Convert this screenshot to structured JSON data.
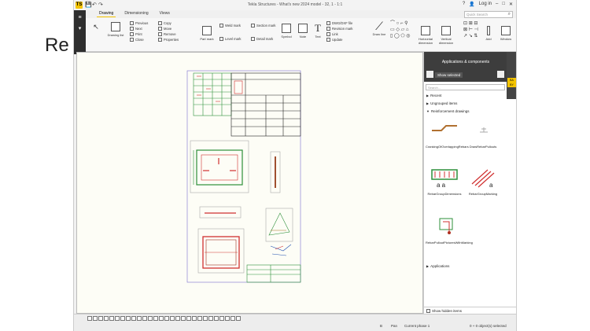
{
  "stray_text": "Re",
  "app": {
    "title": "Tekla Structures - What's new 2024 model - 32, 1 - 1:1",
    "logo": "TS",
    "account": "Log in",
    "window_controls": [
      "?",
      "👤",
      "–",
      "□",
      "✕"
    ]
  },
  "tabs": [
    "Drawing",
    "Dimensioning",
    "Views"
  ],
  "search": {
    "placeholder": "Quick Search"
  },
  "ribbon": {
    "drawing_list": "Drawing list",
    "nav": [
      "Previous",
      "Next",
      "Print",
      "Close"
    ],
    "edit": [
      "Copy",
      "Move",
      "Remove",
      "Properties"
    ],
    "marks": {
      "part_mark": "Part mark",
      "weld_mark": "Weld mark",
      "level_mark": "Level mark",
      "section_mark": "Section mark",
      "detail_mark": "Detail mark"
    },
    "symbol": "Symbol",
    "note": "Note",
    "text": "Text",
    "links": [
      "DWG/DXF file",
      "Revision mark",
      "Link",
      "Update"
    ],
    "draw_line": "Draw line",
    "horizontal_dimension": "Horizontal dimension",
    "vertical_dimension": "Vertical dimension",
    "add": "Add",
    "window": "Window"
  },
  "panel": {
    "title": "Applications & components",
    "show_selected": "Show selected",
    "search_placeholder": "Search...",
    "sections": [
      "Recent",
      "Ungrouped items",
      "Reinforcement drawings",
      "Applications"
    ],
    "components": [
      "CrankingOfOverlappingRebars",
      "DrawRebarPullouts",
      "RebarGroupDimensions",
      "RebarGroupMarking",
      "RebarPulloutPicturesWithMarking"
    ],
    "show_hidden": "Show hidden items"
  },
  "status": {
    "key": "B",
    "pan": "Pan",
    "phase": "Current phase 1",
    "selected": "0 + 0 object(s) selected"
  }
}
